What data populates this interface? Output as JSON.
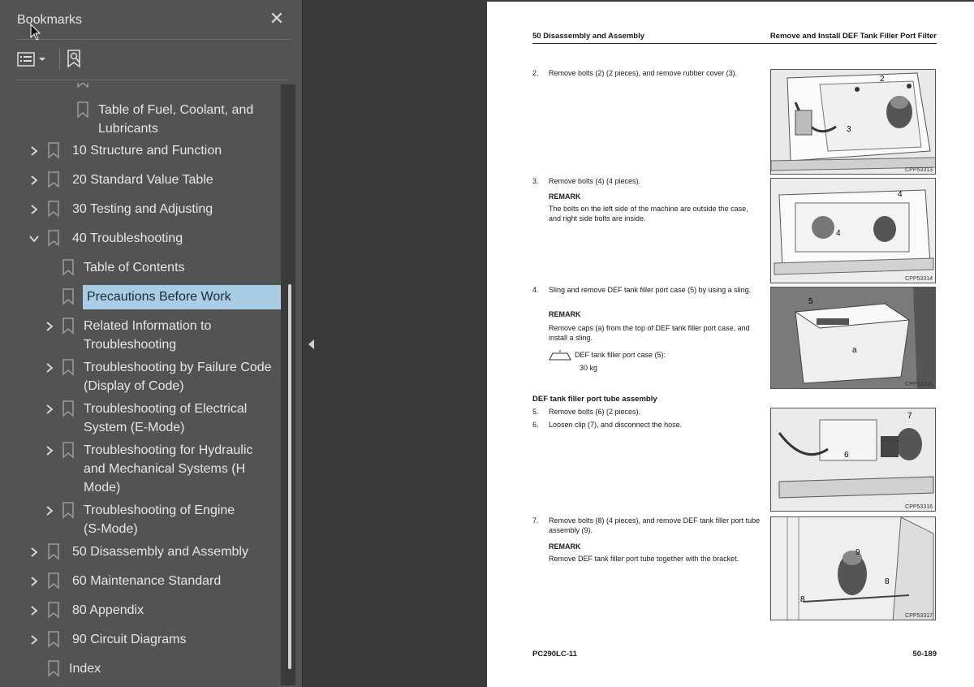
{
  "sidebar": {
    "title": "Bookmarks",
    "close_icon": "close-icon",
    "tools": {
      "options_icon": "list-options-icon",
      "dropdown_icon": "chevron-down-icon",
      "add_icon": "add-bookmark-icon"
    },
    "items": [
      {
        "label": "Table of Fuel, Coolant, and\nLubricants",
        "level": 2,
        "expander": "none"
      },
      {
        "label": "10 Structure and Function",
        "level": 1,
        "expander": "collapsed"
      },
      {
        "label": "20 Standard Value Table",
        "level": 1,
        "expander": "collapsed"
      },
      {
        "label": "30 Testing and Adjusting",
        "level": 1,
        "expander": "collapsed"
      },
      {
        "label": "40 Troubleshooting",
        "level": 1,
        "expander": "expanded"
      },
      {
        "label": "Table of Contents",
        "level": 2,
        "expander": "none"
      },
      {
        "label": "Precautions Before Work",
        "level": 2,
        "expander": "none",
        "selected": true
      },
      {
        "label": "Related Information to\nTroubleshooting",
        "level": 2,
        "expander": "collapsed"
      },
      {
        "label": "Troubleshooting by Failure Code\n(Display of Code)",
        "level": 2,
        "expander": "collapsed"
      },
      {
        "label": "Troubleshooting of Electrical\nSystem (E-Mode)",
        "level": 2,
        "expander": "collapsed"
      },
      {
        "label": "Troubleshooting for Hydraulic\nand Mechanical Systems (H\nMode)",
        "level": 2,
        "expander": "collapsed"
      },
      {
        "label": "Troubleshooting of Engine\n(S-Mode)",
        "level": 2,
        "expander": "collapsed"
      },
      {
        "label": "50 Disassembly and Assembly",
        "level": 1,
        "expander": "collapsed"
      },
      {
        "label": "60 Maintenance Standard",
        "level": 1,
        "expander": "collapsed"
      },
      {
        "label": "80 Appendix",
        "level": 1,
        "expander": "collapsed"
      },
      {
        "label": "90 Circuit Diagrams",
        "level": 1,
        "expander": "collapsed"
      },
      {
        "label": "Index",
        "level": 1,
        "expander": "none"
      }
    ]
  },
  "page": {
    "header_left": "50 Disassembly and Assembly",
    "header_right": "Remove and Install DEF Tank Filler Port Filter",
    "steps": [
      {
        "num": "2.",
        "text": "Remove bolts (2) (2 pieces), and remove rubber cover (3)."
      },
      {
        "num": "3.",
        "text": "Remove bolts (4) (4 pieces).",
        "remark_label": "REMARK",
        "remark": "The bolts on the left side of the machine are outside the case, and right side bolts are inside."
      },
      {
        "num": "4.",
        "text": "Sling and remove DEF tank filler port case (5) by using a sling.",
        "remark_label": "REMARK",
        "remark": "Remove caps (a) from the top of DEF tank filler port case, and install a sling.",
        "weight_label": "DEF tank filler port case (5):",
        "weight_value": "30 kg"
      },
      {
        "num": "5.",
        "text": "Remove bolts (6) (2 pieces)."
      },
      {
        "num": "6.",
        "text": "Loosen clip (7), and disconnect the hose."
      },
      {
        "num": "7.",
        "text": "Remove bolts (8) (4 pieces), and remove DEF tank filler port tube assembly (9).",
        "remark_label": "REMARK",
        "remark": "Remove DEF tank filler port tube together with the bracket."
      }
    ],
    "subheading": "DEF tank filler port tube assembly",
    "figures": [
      {
        "id": "CPP53313",
        "callouts": [
          "2",
          "2",
          "3"
        ]
      },
      {
        "id": "CPP53314",
        "callouts": [
          "4",
          "4",
          "4",
          "4"
        ]
      },
      {
        "id": "CPP53315",
        "callouts": [
          "5",
          "a"
        ]
      },
      {
        "id": "CPP53316",
        "callouts": [
          "7",
          "6"
        ]
      },
      {
        "id": "CPP53317",
        "callouts": [
          "9",
          "8",
          "8"
        ]
      }
    ],
    "footer_left": "PC290LC-11",
    "footer_right": "50-189"
  },
  "colors": {
    "sidebar_bg": "#535353",
    "selection": "#a9cde6",
    "gutter": "#3a3a3a",
    "page": "#ffffff"
  }
}
